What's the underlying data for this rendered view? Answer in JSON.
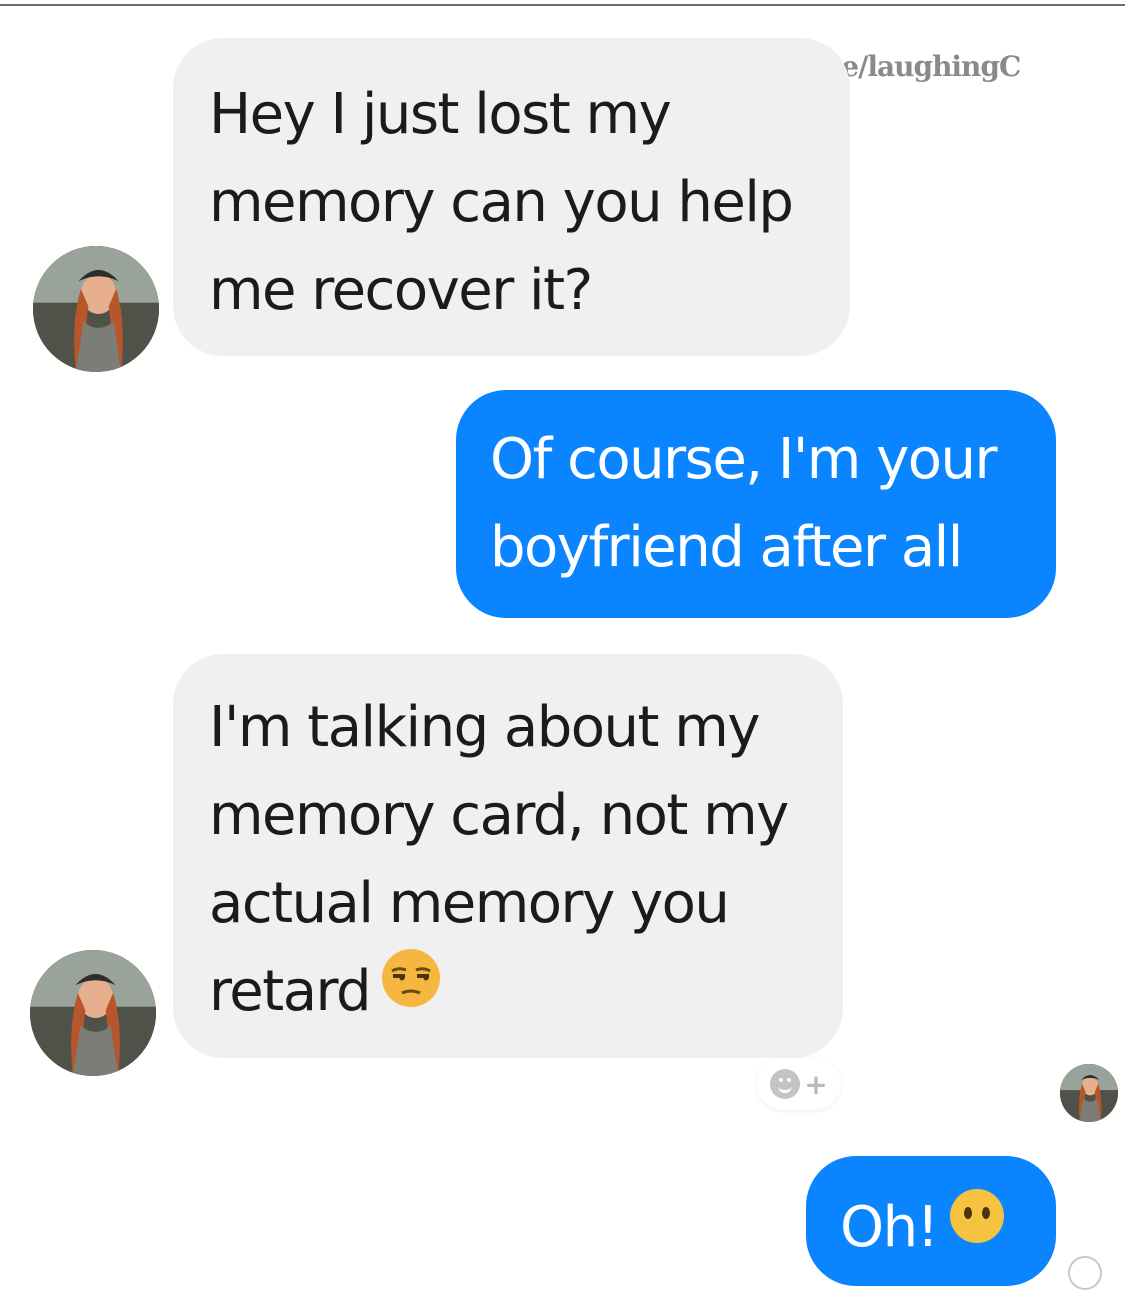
{
  "watermark": {
    "icon": "laughing-emoji-icon",
    "text": "t.me/laughingC"
  },
  "colors": {
    "incoming_bubble": "#f0f0f0",
    "outgoing_bubble": "#0a84ff",
    "incoming_text": "#1b1b1b",
    "outgoing_text": "#ffffff"
  },
  "messages": [
    {
      "sender": "contact",
      "lines": [
        "Hey I just lost my",
        "memory can you help",
        "me recover it?"
      ]
    },
    {
      "sender": "me",
      "lines": [
        "Of course, I'm your",
        "boyfriend after all"
      ]
    },
    {
      "sender": "contact",
      "lines": [
        "I'm talking about my",
        "memory card, not my",
        "actual memory you",
        "retard"
      ],
      "emoji": "unamused-face-icon"
    },
    {
      "sender": "me",
      "lines": [
        "Oh!"
      ],
      "emoji": "face-without-mouth-icon"
    }
  ],
  "reaction_button": {
    "icon": "add-reaction-icon",
    "plus": "+"
  }
}
